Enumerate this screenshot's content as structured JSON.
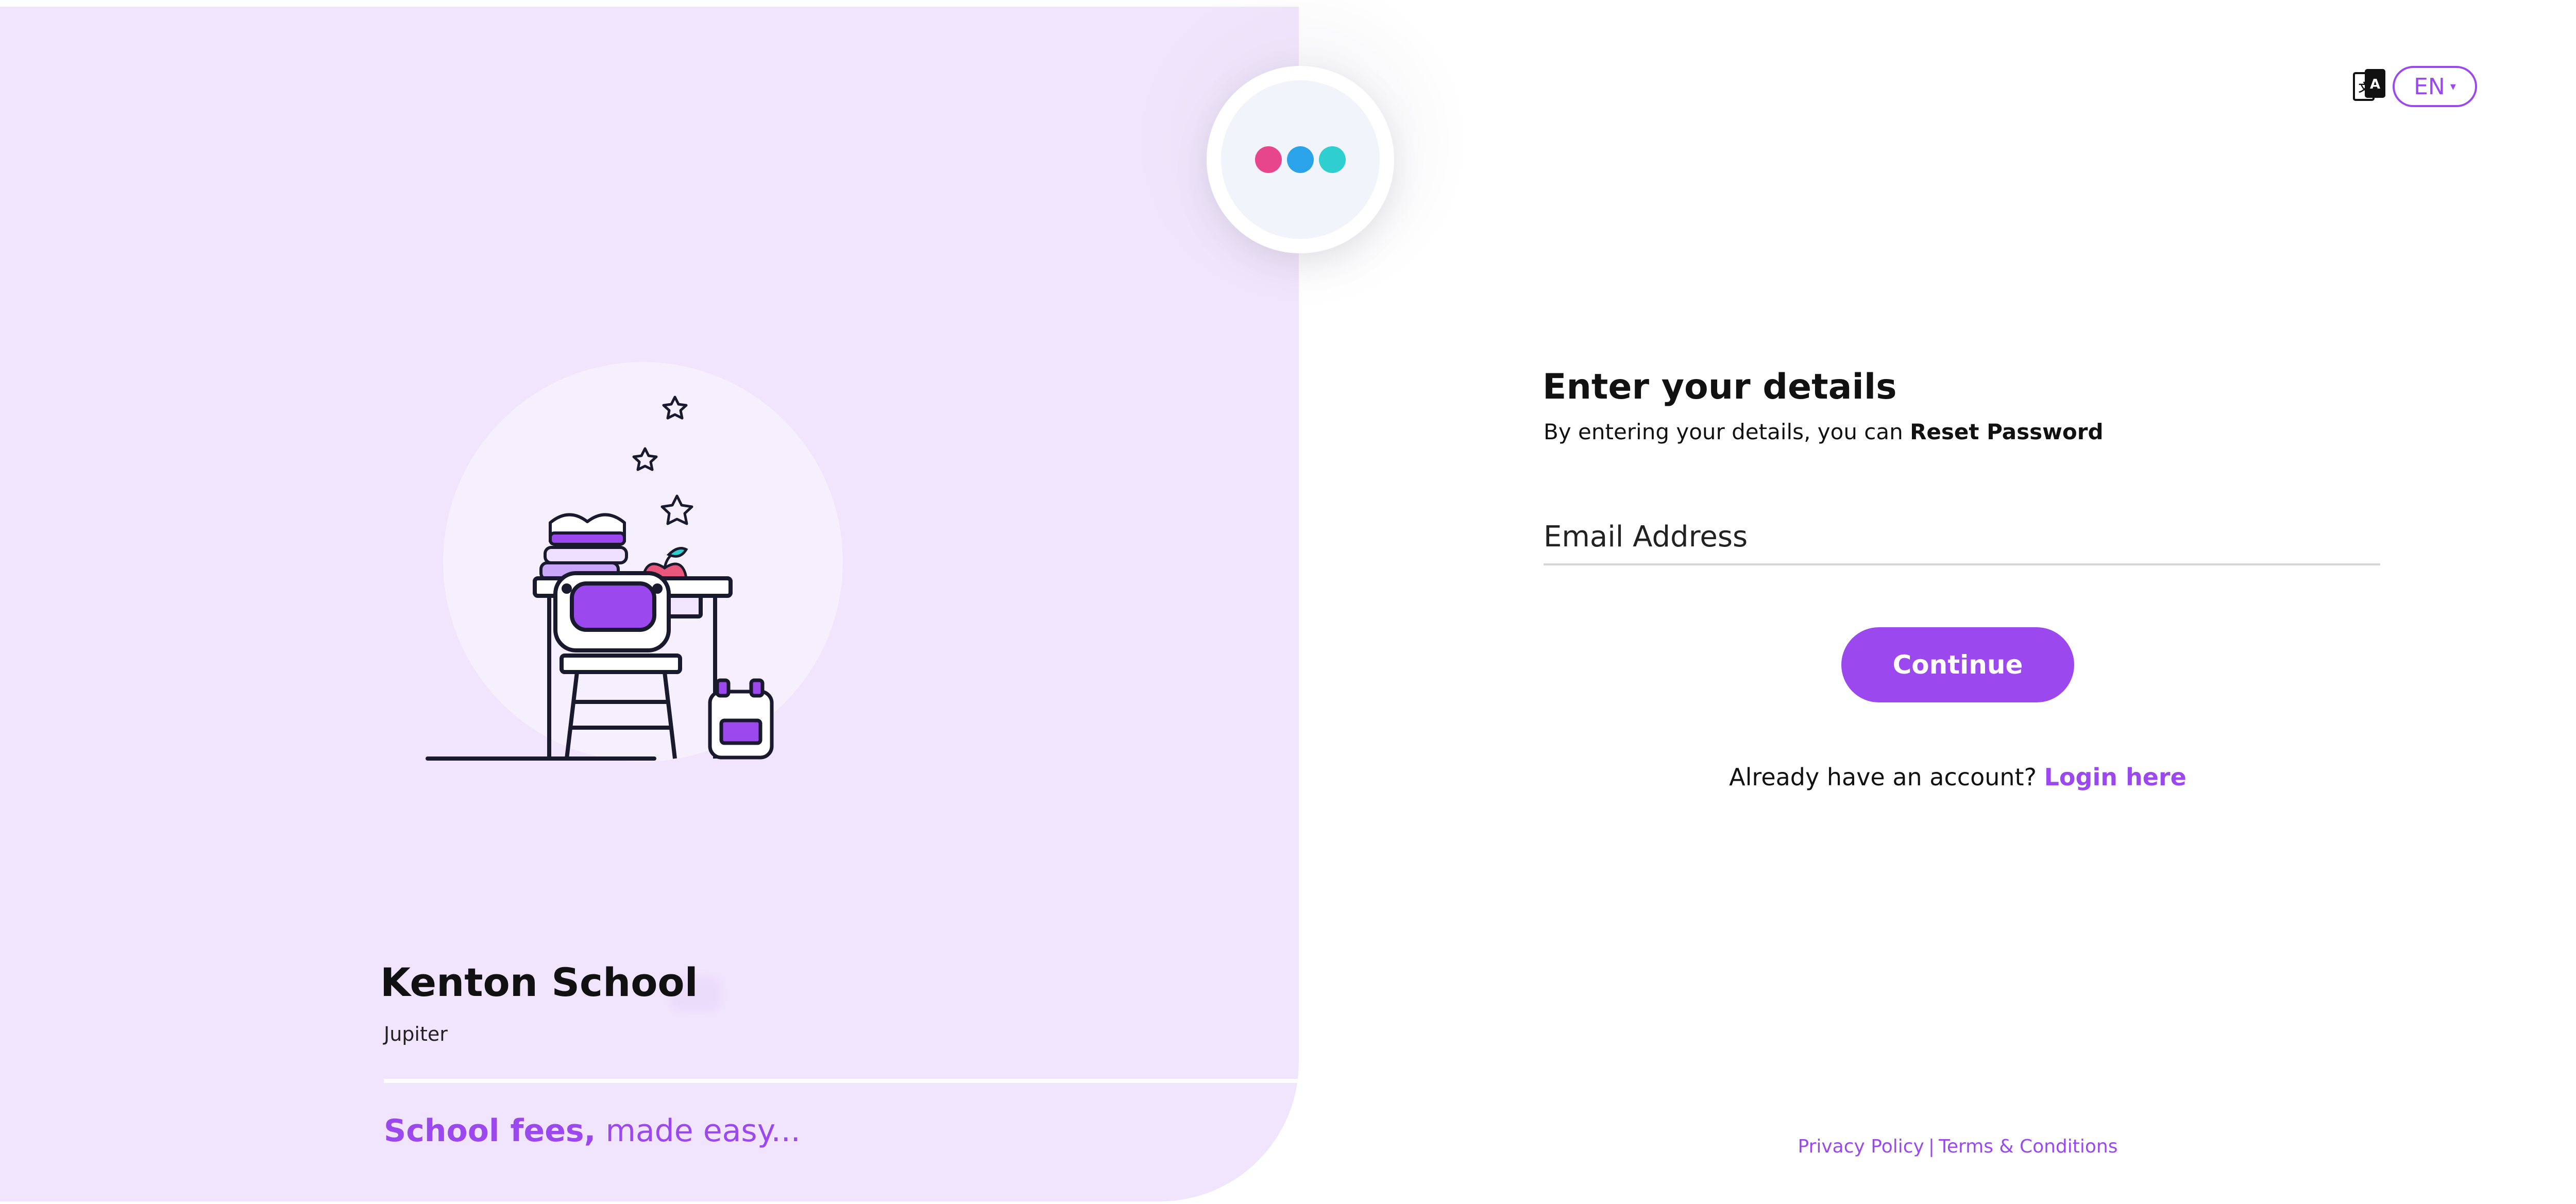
{
  "school": {
    "name": "Kenton School",
    "location": "Jupiter"
  },
  "tagline": {
    "bold": "School fees,",
    "rest": " made easy..."
  },
  "logo": {
    "dots": [
      "#e8468a",
      "#2aa3ea",
      "#2fcfd0"
    ]
  },
  "language": {
    "icon": "translate-icon",
    "selected": "EN",
    "caret": "▾"
  },
  "form": {
    "title": "Enter your details",
    "subtitle_prefix": "By entering your details, you can ",
    "subtitle_action": "Reset Password",
    "email_placeholder": "Email Address",
    "email_value": "",
    "continue_label": "Continue"
  },
  "login": {
    "prompt": "Already have an account? ",
    "link_label": "Login here"
  },
  "footer": {
    "privacy": "Privacy Policy",
    "separator": "|",
    "terms": "Terms & Conditions"
  },
  "colors": {
    "accent": "#9b49ee",
    "panel_background": "#f1e4fd"
  }
}
